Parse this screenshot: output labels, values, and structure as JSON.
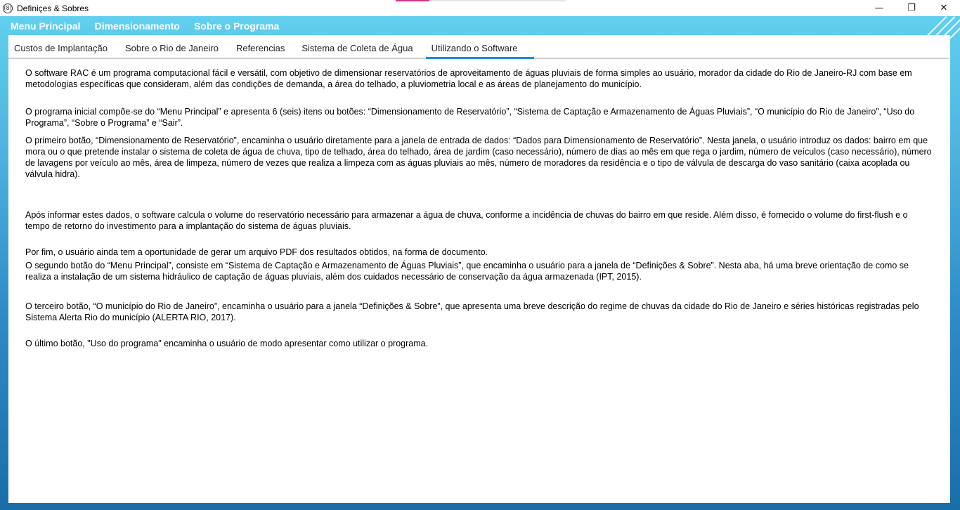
{
  "window": {
    "title": "Definiçes & Sobres",
    "app_icon": "(8)",
    "controls": {
      "minimize": "—",
      "maximize": "❐",
      "close": "✕"
    }
  },
  "menu": {
    "items": [
      "Menu Principal",
      "Dimensionamento",
      "Sobre o Programa"
    ]
  },
  "tabs": {
    "items": [
      "Custos de Implantação",
      "Sobre o Rio de Janeiro",
      "Referencias",
      "Sistema de Coleta de Água",
      "Utilizando o Software"
    ],
    "active": "Utilizando o Software"
  },
  "content": {
    "paragraphs": [
      "O software RAC é um programa computacional fácil e versátil, com objetivo de dimensionar reservatórios de aproveitamento de águas pluviais de forma simples ao usuário, morador da cidade do Rio de Janeiro-RJ com base em metodologias específicas que consideram, além das condições de demanda, a área do telhado, a pluviometria local e as áreas de planejamento do município.",
      "O programa inicial compõe-se do “Menu Principal” e apresenta 6 (seis) itens ou botões: “Dimensionamento de Reservatório”, “Sistema de Captação e Armazenamento de Águas Pluviais”, “O município do Rio de Janeiro”, “Uso do Programa”, “Sobre o Programa” e “Sair”.",
      "O primeiro botão, “Dimensionamento de Reservatório”, encaminha o usuário diretamente para a janela de entrada de dados: “Dados para Dimensionamento de Reservatório”. Nesta janela, o usuário introduz os dados: bairro em que mora ou o que pretende instalar o sistema de coleta de água de chuva, tipo de telhado, área do telhado, área de jardim (caso necessário), número de dias ao mês em que rega o jardim, número de veículos (caso necessário), número de lavagens por veículo ao mês, área de limpeza, número de vezes que realiza a limpeza com as águas pluviais ao mês, número de moradores da residência e o tipo de válvula de descarga do vaso sanitário (caixa acoplada ou válvula hidra).",
      "Após informar estes dados, o software calcula o volume do reservatório necessário para armazenar a água de chuva, conforme a incidência de chuvas do bairro em que reside. Além disso, é fornecido o volume do first-flush e o tempo de retorno do investimento para a implantação do sistema de águas pluviais.",
      "Por fim, o usuário ainda tem a oportunidade de gerar um arquivo PDF dos resultados obtidos, na forma de documento.",
      "O segundo botão do “Menu Principal”, consiste em “Sistema de Captação e Armazenamento de Águas Pluviais”, que encaminha o usuário para a janela de “Definições & Sobre”. Nesta aba, há uma breve orientação de como se realiza a instalação de um sistema hidráulico de captação de águas pluviais, além dos cuidados necessário de conservação da água armazenada (IPT, 2015).",
      "O terceiro botão, “O município do Rio de Janeiro”, encaminha o usuário para a janela “Definições & Sobre”, que apresenta uma breve descrição do regime de chuvas da cidade do Rio de Janeiro e séries históricas registradas pelo Sistema Alerta Rio do município (ALERTA RIO, 2017).",
      "O último botão, \"Uso do programa\" encaminha o usuário de modo apresentar como utilizar o programa."
    ]
  }
}
